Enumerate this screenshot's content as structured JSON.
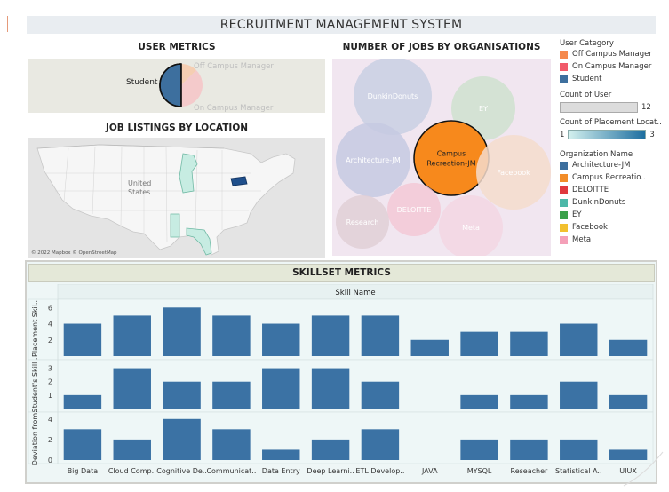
{
  "app_title": "RECRUITMENT MANAGEMENT SYSTEM",
  "user_metrics": {
    "title": "USER METRICS",
    "student_label": "Student",
    "off_campus_label": "Off Campus Manager",
    "on_campus_label": "On Campus Manager"
  },
  "jobs_by_org": {
    "title": "NUMBER OF JOBS BY ORGANISATIONS",
    "bubbles": [
      {
        "name": "DunkinDonuts",
        "label": "DunkinDonuts",
        "color": "#c9cfe3"
      },
      {
        "name": "EY",
        "label": "EY",
        "color": "#cfe1cf"
      },
      {
        "name": "Architecture-JM",
        "label": "Architecture-JM",
        "color": "#c6c9e2"
      },
      {
        "name": "Campus Recreation-JM",
        "label": "Campus Recreation-JM",
        "color": "#f7891c"
      },
      {
        "name": "Facebook",
        "label": "Facebook",
        "color": "#f5dccd"
      },
      {
        "name": "DELOITTE",
        "label": "DELOITTE",
        "color": "#f3c8d6"
      },
      {
        "name": "Research",
        "label": "Research",
        "color": "#e1cfd6"
      },
      {
        "name": "Meta",
        "label": "Meta",
        "color": "#f3d6e3"
      }
    ]
  },
  "job_listings": {
    "title": "JOB LISTINGS BY LOCATION",
    "map_label": "United States",
    "attribution": "© 2022 Mapbox © OpenStreetMap"
  },
  "legend": {
    "user_category_title": "User Category",
    "user_categories": [
      {
        "label": "Off Campus Manager",
        "color": "#f5894d"
      },
      {
        "label": "On Campus Manager",
        "color": "#f15a6a"
      },
      {
        "label": "Student",
        "color": "#3d6f9e"
      }
    ],
    "count_user_title": "Count of User",
    "count_user_value": "12",
    "count_placement_title": "Count of Placement Locat..",
    "count_placement_min": "1",
    "count_placement_max": "3",
    "org_title": "Organization Name",
    "orgs": [
      {
        "label": "Architecture-JM",
        "color": "#3d6f9e"
      },
      {
        "label": "Campus Recreatio..",
        "color": "#f28c28"
      },
      {
        "label": "DELOITTE",
        "color": "#e0393e"
      },
      {
        "label": "DunkinDonuts",
        "color": "#4cb8a8"
      },
      {
        "label": "EY",
        "color": "#3aa14a"
      },
      {
        "label": "Facebook",
        "color": "#f2c02e"
      },
      {
        "label": "Meta",
        "color": "#f4a0b8"
      }
    ]
  },
  "skillset": {
    "title": "SKILLSET METRICS",
    "column_header": "Skill Name"
  },
  "chart_data": {
    "type": "bar",
    "bar_color": "#3b72a4",
    "categories": [
      "Big Data",
      "Cloud Comp..",
      "Cognitive De..",
      "Communicat..",
      "Data Entry",
      "Deep Learni..",
      "ETL Develop..",
      "JAVA",
      "MYSQL",
      "Reseacher",
      "Statistical A..",
      "UIUX"
    ],
    "panels": [
      {
        "ylabel": "Placement Skil..",
        "ylim": [
          0,
          6.8
        ],
        "ticks": [
          2,
          4,
          6
        ],
        "values": [
          4,
          5,
          6,
          5,
          4,
          5,
          5,
          2,
          3,
          3,
          4,
          2
        ]
      },
      {
        "ylabel": "Student's Skill..",
        "ylim": [
          0,
          3.5
        ],
        "ticks": [
          1,
          2,
          3
        ],
        "values": [
          1,
          3,
          2,
          2,
          3,
          3,
          2,
          0,
          1,
          1,
          2,
          1
        ]
      },
      {
        "ylabel": "Deviation from..",
        "ylim": [
          0,
          4.5
        ],
        "ticks": [
          0,
          2,
          4
        ],
        "values": [
          3,
          2,
          4,
          3,
          1,
          2,
          3,
          0,
          2,
          2,
          2,
          1
        ]
      }
    ]
  }
}
